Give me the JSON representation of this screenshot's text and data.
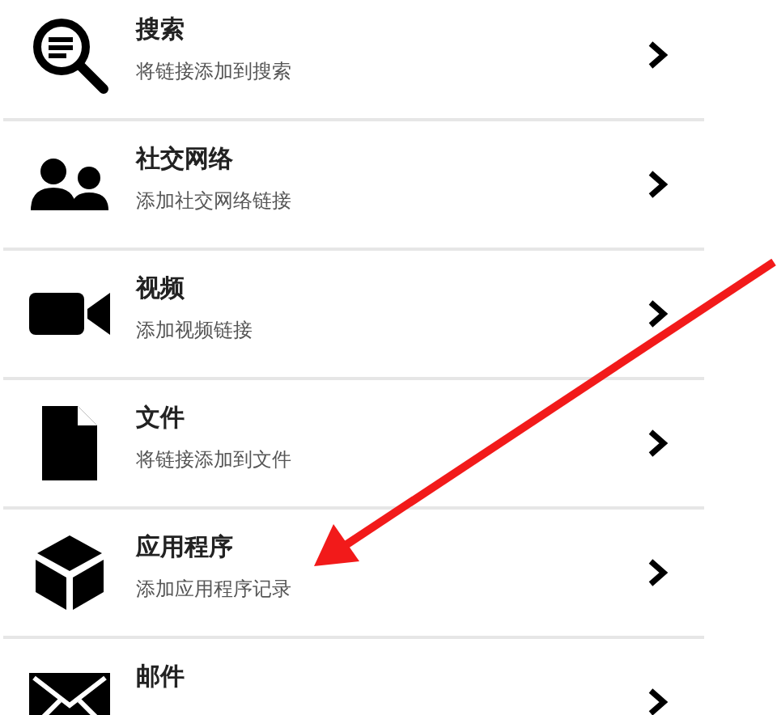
{
  "items": [
    {
      "kind": "search",
      "title": "搜索",
      "subtitle": "将链接添加到搜索"
    },
    {
      "kind": "people",
      "title": "社交网络",
      "subtitle": "添加社交网络链接"
    },
    {
      "kind": "video",
      "title": "视频",
      "subtitle": "添加视频链接"
    },
    {
      "kind": "file",
      "title": "文件",
      "subtitle": "将链接添加到文件"
    },
    {
      "kind": "box",
      "title": "应用程序",
      "subtitle": "添加应用程序记录"
    },
    {
      "kind": "mail",
      "title": "邮件"
    }
  ]
}
